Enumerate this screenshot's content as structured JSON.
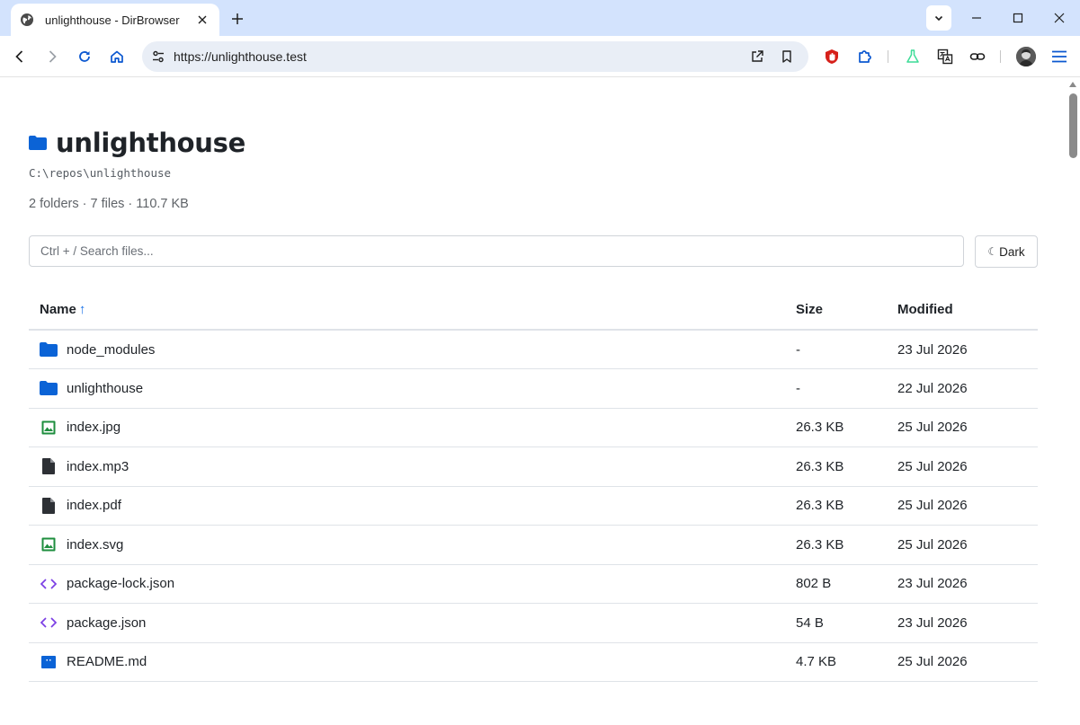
{
  "browser": {
    "tab_title": "unlighthouse - DirBrowser",
    "url": "https://unlighthouse.test"
  },
  "page": {
    "title": "unlighthouse",
    "path": "C:\\repos\\unlighthouse",
    "summary": "2 folders · 7 files · 110.7 KB",
    "search_placeholder": "Ctrl + / Search files...",
    "theme_moon": "☾",
    "theme_label": "Dark"
  },
  "table": {
    "headers": {
      "name": "Name",
      "sort_indicator": "↑",
      "size": "Size",
      "modified": "Modified"
    },
    "rows": [
      {
        "name": "node_modules",
        "size": "-",
        "modified": "23 Jul 2026",
        "icon": "folder-icon",
        "icon_color": "#0b63d6"
      },
      {
        "name": "unlighthouse",
        "size": "-",
        "modified": "22 Jul 2026",
        "icon": "folder-icon",
        "icon_color": "#0b63d6"
      },
      {
        "name": "index.jpg",
        "size": "26.3 KB",
        "modified": "25 Jul 2026",
        "icon": "image-file-icon",
        "icon_color": "#1e8e3e"
      },
      {
        "name": "index.mp3",
        "size": "26.3 KB",
        "modified": "25 Jul 2026",
        "icon": "file-icon",
        "icon_color": "#2d3035"
      },
      {
        "name": "index.pdf",
        "size": "26.3 KB",
        "modified": "25 Jul 2026",
        "icon": "file-icon",
        "icon_color": "#2d3035"
      },
      {
        "name": "index.svg",
        "size": "26.3 KB",
        "modified": "25 Jul 2026",
        "icon": "image-file-icon",
        "icon_color": "#1e8e3e"
      },
      {
        "name": "package-lock.json",
        "size": "802 B",
        "modified": "23 Jul 2026",
        "icon": "code-file-icon",
        "icon_color": "#7b3fe4"
      },
      {
        "name": "package.json",
        "size": "54 B",
        "modified": "23 Jul 2026",
        "icon": "code-file-icon",
        "icon_color": "#7b3fe4"
      },
      {
        "name": "README.md",
        "size": "4.7 KB",
        "modified": "25 Jul 2026",
        "icon": "markdown-file-icon",
        "icon_color": "#0b63d6"
      }
    ]
  },
  "colors": {
    "tabstrip": "#d3e3fd",
    "omnibox": "#e9eef6",
    "accent": "#1a73e8"
  }
}
